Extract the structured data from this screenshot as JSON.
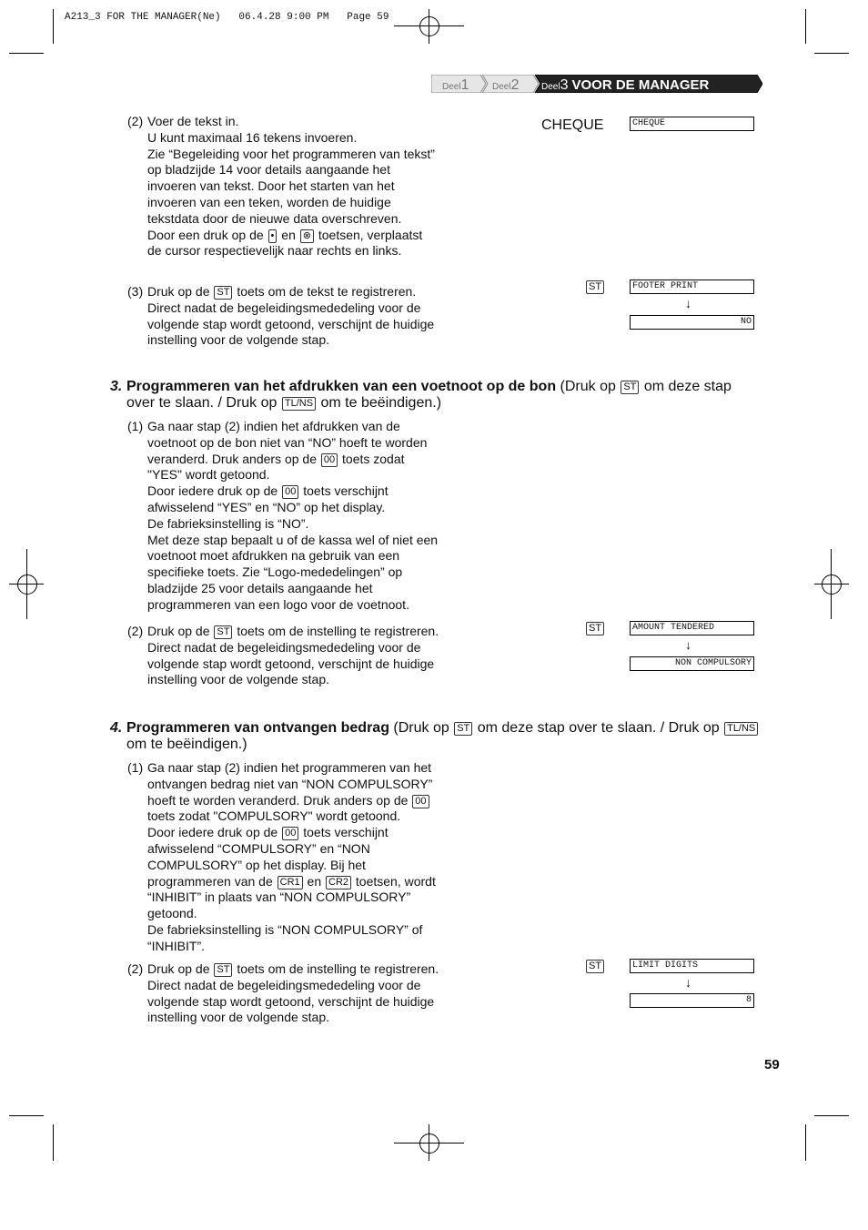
{
  "slug": "A213_3 FOR THE MANAGER(Ne)   06.4.28 9:00 PM   Page 59",
  "tabs": [
    {
      "prefix": "Deel",
      "num": "1"
    },
    {
      "prefix": "Deel",
      "num": "2"
    },
    {
      "prefix": "Deel",
      "num": "3",
      "title": "VOOR DE MANAGER"
    }
  ],
  "page_number": "59",
  "blocks": {
    "s2": [
      [
        "(2) ",
        "Voer de tekst in."
      ],
      [
        "",
        "U kunt maximaal 16 tekens invoeren."
      ],
      [
        "",
        "Zie “Begeleiding voor het programmeren van tekst”"
      ],
      [
        "",
        "op bladzijde 14 voor details aangaande het"
      ],
      [
        "",
        "invoeren van tekst. Door het starten van het"
      ],
      [
        "",
        "invoeren van een teken, worden de huidige"
      ],
      [
        "",
        "tekstdata door de nieuwe data overschreven."
      ],
      [
        "",
        "Door een druk op de ",
        {
          "k": "•"
        },
        " en ",
        {
          "k": "⊗"
        },
        " toetsen, verplaatst"
      ],
      [
        "",
        "de cursor respectievelijk naar rechts en links."
      ]
    ],
    "s3": [
      [
        "(3) ",
        "Druk op de ",
        {
          "k": "ST"
        },
        " toets om de tekst te registreren."
      ],
      [
        "",
        "Direct nadat de begeleidingsmededeling voor de"
      ],
      [
        "",
        "volgende stap wordt getoond, verschijnt de huidige"
      ],
      [
        "",
        "instelling voor de volgende stap."
      ]
    ],
    "p3_1": [
      [
        "(1) ",
        "Ga naar stap (2) indien het afdrukken van de"
      ],
      [
        "",
        "voetnoot op de bon niet van “NO” hoeft te worden"
      ],
      [
        "",
        "veranderd. Druk anders op de ",
        {
          "k": "00"
        },
        " toets zodat"
      ],
      [
        "",
        "\"YES\" wordt getoond."
      ],
      [
        "",
        "Door iedere druk op de ",
        {
          "k": "00"
        },
        " toets verschijnt"
      ],
      [
        "",
        "afwisselend “YES” en “NO” op het display."
      ],
      [
        "",
        "De fabrieksinstelling is “NO”."
      ],
      [
        "",
        "Met deze stap bepaalt u of de kassa wel of niet een"
      ],
      [
        "",
        "voetnoot moet afdrukken na gebruik van een"
      ],
      [
        "",
        "specifieke toets. Zie “Logo-mededelingen” op"
      ],
      [
        "",
        "bladzijde 25 voor details aangaande het"
      ],
      [
        "",
        "programmeren van een logo voor de voetnoot."
      ]
    ],
    "p3_2": [
      [
        "(2) ",
        "Druk op de ",
        {
          "k": "ST"
        },
        " toets om de instelling te registreren."
      ],
      [
        "",
        "Direct nadat de begeleidingsmededeling voor de"
      ],
      [
        "",
        "volgende stap wordt getoond, verschijnt de huidige"
      ],
      [
        "",
        "instelling voor de volgende stap."
      ]
    ],
    "p4_1": [
      [
        "(1) ",
        "Ga naar stap (2) indien het programmeren van het"
      ],
      [
        "",
        "ontvangen bedrag niet van “NON COMPULSORY”"
      ],
      [
        "",
        "hoeft te worden veranderd. Druk anders op de ",
        {
          "k": "00"
        }
      ],
      [
        "",
        "toets zodat \"COMPULSORY\" wordt getoond."
      ],
      [
        "",
        "Door iedere druk op de ",
        {
          "k": "00"
        },
        " toets verschijnt"
      ],
      [
        "",
        "afwisselend “COMPULSORY” en “NON"
      ],
      [
        "",
        "COMPULSORY” op het display. Bij het"
      ],
      [
        "",
        "programmeren van de ",
        {
          "k": "CR1"
        },
        " en ",
        {
          "k": "CR2"
        },
        " toetsen, wordt"
      ],
      [
        "",
        "“INHIBIT” in plaats van “NON COMPULSORY”"
      ],
      [
        "",
        "getoond."
      ],
      [
        "",
        "De fabrieksinstelling is “NON COMPULSORY” of"
      ],
      [
        "",
        "“INHIBIT”."
      ]
    ],
    "p4_2": [
      [
        "(2) ",
        "Druk op de ",
        {
          "k": "ST"
        },
        " toets om de instelling te registreren."
      ],
      [
        "",
        "Direct nadat de begeleidingsmededeling voor de"
      ],
      [
        "",
        "volgende stap wordt getoond, verschijnt de huidige"
      ],
      [
        "",
        "instelling voor de volgende stap."
      ]
    ]
  },
  "headings": {
    "h3": [
      [
        "3. ",
        "Programmeren van het afdrukken van een voetnoot op de bon",
        " (Druk op ",
        {
          "k": "ST"
        },
        " om deze stap"
      ],
      [
        "",
        "over te slaan. / Druk op ",
        {
          "k": "TL/NS"
        },
        " om te beëindigen.)"
      ]
    ],
    "h4": [
      [
        "4. ",
        "Programmeren van ontvangen bedrag",
        " (Druk op ",
        {
          "k": "ST"
        },
        " om deze stap over te slaan. / Druk op ",
        {
          "k": "TL/NS"
        }
      ],
      [
        "",
        "om te beëindigen.)"
      ]
    ]
  },
  "right": {
    "cheque_label": "CHEQUE",
    "cheque_display": "CHEQUE",
    "st_key": "ST",
    "d1a": "FOOTER PRINT",
    "d1b": "NO",
    "d2a": "AMOUNT TENDERED",
    "d2b": "NON COMPULSORY",
    "d3a": "LIMIT DIGITS",
    "d3b": "8",
    "arrow": "↓"
  }
}
